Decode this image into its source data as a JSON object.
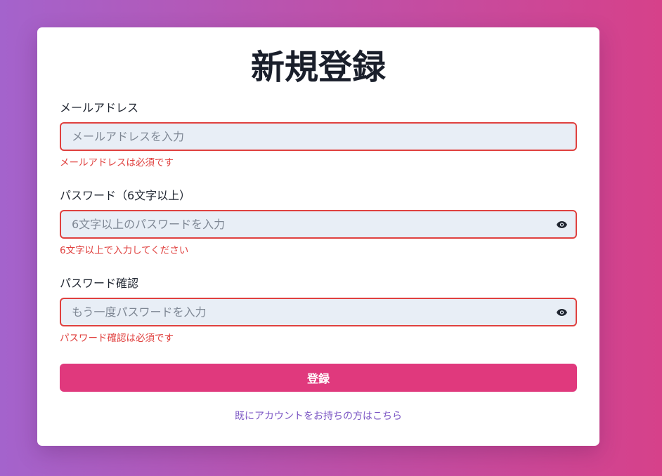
{
  "form": {
    "title": "新規登録",
    "email": {
      "label": "メールアドレス",
      "placeholder": "メールアドレスを入力",
      "value": "",
      "error": "メールアドレスは必須です"
    },
    "password": {
      "label": "パスワード（6文字以上）",
      "placeholder": "6文字以上のパスワードを入力",
      "value": "",
      "error": "6文字以上で入力してください",
      "toggle_icon": "eye-icon"
    },
    "password_confirm": {
      "label": "パスワード確認",
      "placeholder": "もう一度パスワードを入力",
      "value": "",
      "error": "パスワード確認は必須です",
      "toggle_icon": "eye-icon"
    },
    "submit_label": "登録",
    "login_link": "既にアカウントをお持ちの方はこちら"
  },
  "colors": {
    "accent": "#e0397d",
    "error": "#e0413f",
    "link": "#7b56c4",
    "input_bg": "#e8eef6"
  }
}
